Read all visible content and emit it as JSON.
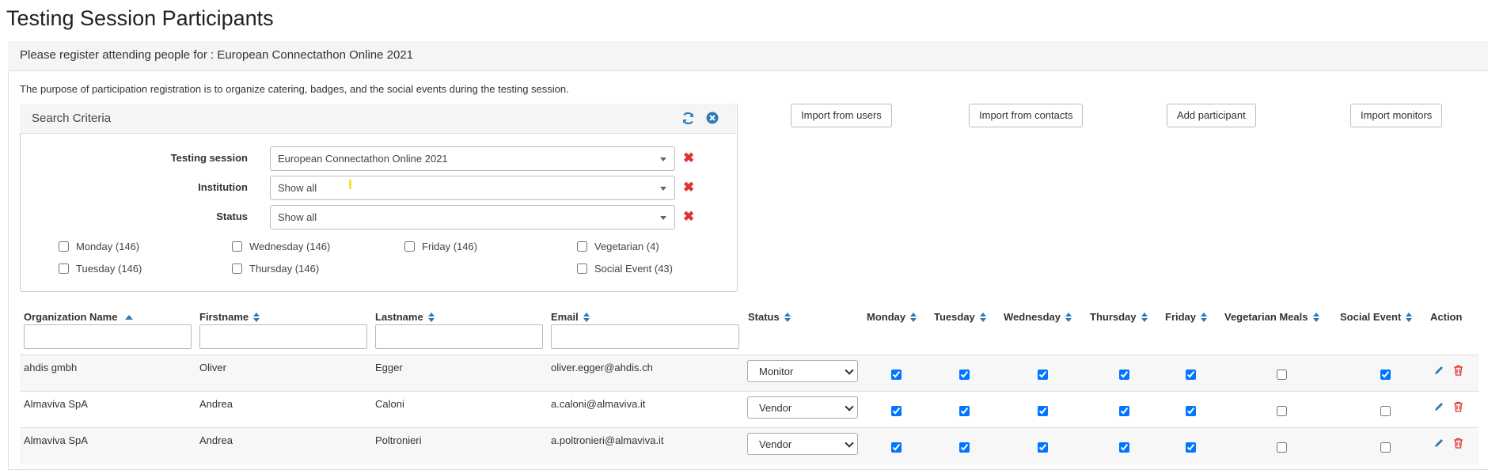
{
  "page": {
    "title": "Testing Session Participants"
  },
  "panel": {
    "heading": "Please register attending people for : European Connectathon Online 2021",
    "purpose": "The purpose of participation registration is to organize catering, badges, and the social events during the testing session."
  },
  "search": {
    "title": "Search Criteria",
    "fields": [
      {
        "label": "Testing session",
        "value": "European Connectathon Online 2021"
      },
      {
        "label": "Institution",
        "value": "Show all"
      },
      {
        "label": "Status",
        "value": "Show all"
      }
    ],
    "checkboxes": [
      {
        "label": "Monday (146)",
        "checked": false
      },
      {
        "label": "Wednesday (146)",
        "checked": false
      },
      {
        "label": "Friday (146)",
        "checked": false
      },
      {
        "label": "Vegetarian (4)",
        "checked": false
      },
      {
        "label": "Tuesday (146)",
        "checked": false
      },
      {
        "label": "Thursday (146)",
        "checked": false
      },
      {
        "label": "Social Event (43)",
        "checked": false
      }
    ]
  },
  "actions": {
    "import_users": "Import from users",
    "import_contacts": "Import from contacts",
    "add_participant": "Add participant",
    "import_monitors": "Import monitors"
  },
  "table": {
    "columns": [
      "Organization Name",
      "Firstname",
      "Lastname",
      "Email",
      "Status",
      "Monday",
      "Tuesday",
      "Wednesday",
      "Thursday",
      "Friday",
      "Vegetarian Meals",
      "Social Event",
      "Action"
    ],
    "rows": [
      {
        "org": "ahdis gmbh",
        "first": "Oliver",
        "last": "Egger",
        "email": "oliver.egger@ahdis.ch",
        "status": "Monitor",
        "checks": [
          true,
          true,
          true,
          true,
          true,
          false,
          true
        ]
      },
      {
        "org": "Almaviva SpA",
        "first": "Andrea",
        "last": "Caloni",
        "email": "a.caloni@almaviva.it",
        "status": "Vendor",
        "checks": [
          true,
          true,
          true,
          true,
          true,
          false,
          false
        ]
      },
      {
        "org": "Almaviva SpA",
        "first": "Andrea",
        "last": "Poltronieri",
        "email": "a.poltronieri@almaviva.it",
        "status": "Vendor",
        "checks": [
          true,
          true,
          true,
          true,
          true,
          false,
          false
        ]
      }
    ]
  },
  "colors": {
    "accent": "#2c7ab8",
    "danger": "#e03434"
  }
}
